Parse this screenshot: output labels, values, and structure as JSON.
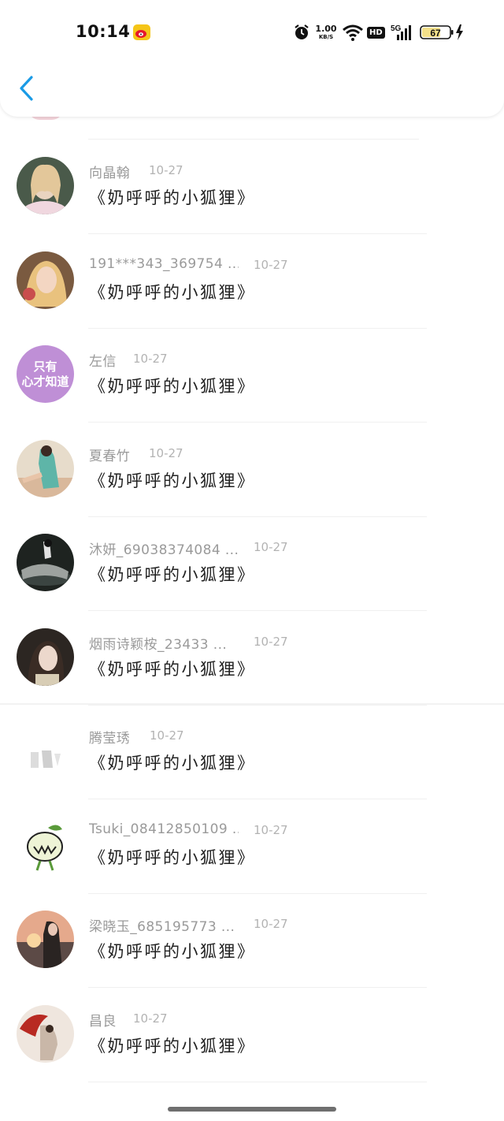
{
  "status_bar": {
    "time": "10:14",
    "net_speed_value": "1.00",
    "net_speed_unit": "KB/S",
    "hd_label": "HD",
    "network_label": "5G",
    "battery_level": "67"
  },
  "colors": {
    "accent": "#1a9be6",
    "weibo_yellow": "#f5c518",
    "battery_fill": "#f3e08a"
  },
  "items": [
    {
      "username": "向晶翰",
      "date": "10-27",
      "title": "《奶呼呼的小狐狸》"
    },
    {
      "username": "191***343_369754 ...",
      "date": "10-27",
      "title": "《奶呼呼的小狐狸》"
    },
    {
      "username": "左信",
      "date": "10-27",
      "title": "《奶呼呼的小狐狸》",
      "avatar_text_1": "只有",
      "avatar_text_2": "心才知道"
    },
    {
      "username": "夏春竹",
      "date": "10-27",
      "title": "《奶呼呼的小狐狸》"
    },
    {
      "username": "沐妍_69038374084 ...",
      "date": "10-27",
      "title": "《奶呼呼的小狐狸》"
    },
    {
      "username": "烟雨诗颖桉_23433 ...",
      "date": "10-27",
      "title": "《奶呼呼的小狐狸》"
    },
    {
      "username": "腾莹琇",
      "date": "10-27",
      "title": "《奶呼呼的小狐狸》"
    },
    {
      "username": "Tsuki_08412850109 ...",
      "date": "10-27",
      "title": "《奶呼呼的小狐狸》"
    },
    {
      "username": "梁晓玉_685195773 ...",
      "date": "10-27",
      "title": "《奶呼呼的小狐狸》"
    },
    {
      "username": "昌良",
      "date": "10-27",
      "title": "《奶呼呼的小狐狸》"
    }
  ]
}
